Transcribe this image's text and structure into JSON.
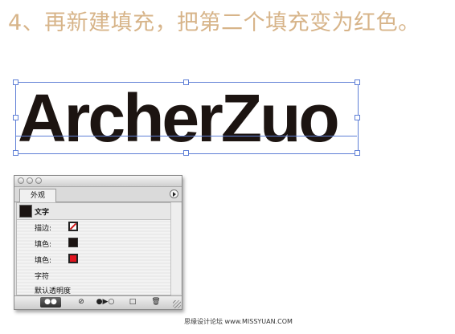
{
  "step_title": "4、再新建填充，把第二个填充变为红色。",
  "canvas": {
    "text": "ArcherZuo"
  },
  "panel": {
    "tab": "外观",
    "header": "文字",
    "rows": [
      {
        "label": "描边:",
        "swatch": "none"
      },
      {
        "label": "填色:",
        "swatch": "#1b1412"
      },
      {
        "label": "填色:",
        "swatch": "#e0141e"
      },
      {
        "label": "字符"
      },
      {
        "label": "默认透明度"
      }
    ],
    "bottom_buttons": [
      "●●",
      "⊘",
      "●▶○",
      "□",
      "🗑"
    ]
  },
  "footer": "思缘设计论坛  www.MISSYUAN.COM",
  "colors": {
    "title": "#d7b489",
    "selection": "#5f7fd6",
    "text": "#1c1411",
    "red_fill": "#e0141e"
  }
}
